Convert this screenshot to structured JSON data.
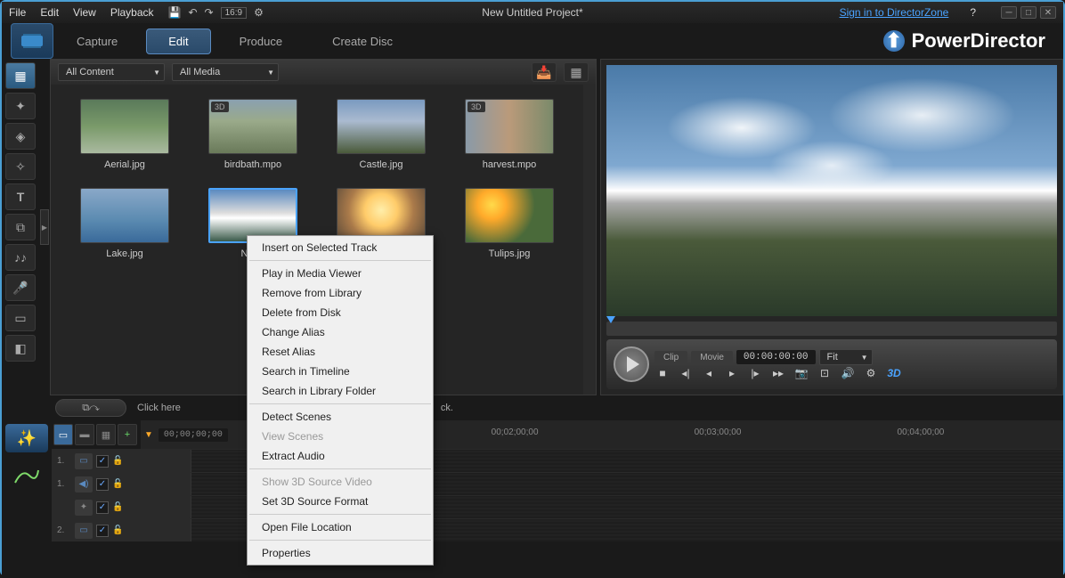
{
  "menubar": {
    "items": [
      "File",
      "Edit",
      "View",
      "Playback"
    ],
    "title": "New Untitled Project*",
    "signin": "Sign in to DirectorZone",
    "aspect": "16:9"
  },
  "tabs": {
    "items": [
      "Capture",
      "Edit",
      "Produce",
      "Create Disc"
    ],
    "active": 1,
    "brand": "PowerDirector"
  },
  "media": {
    "filter_content": "All Content",
    "filter_media": "All Media",
    "items": [
      {
        "label": "Aerial.jpg",
        "badge3d": false,
        "thumb": "th-aerial"
      },
      {
        "label": "birdbath.mpo",
        "badge3d": true,
        "thumb": "th-birdbath"
      },
      {
        "label": "Castle.jpg",
        "badge3d": false,
        "thumb": "th-castle"
      },
      {
        "label": "harvest.mpo",
        "badge3d": true,
        "thumb": "th-harvest"
      },
      {
        "label": "Lake.jpg",
        "badge3d": false,
        "thumb": "th-lake"
      },
      {
        "label": "Natur",
        "badge3d": false,
        "thumb": "th-nature",
        "selected": true
      },
      {
        "label": "",
        "badge3d": false,
        "thumb": "th-sunset"
      },
      {
        "label": "Tulips.jpg",
        "badge3d": false,
        "thumb": "th-tulips"
      }
    ]
  },
  "context_menu": [
    {
      "label": "Insert on Selected Track",
      "enabled": true
    },
    {
      "sep": true
    },
    {
      "label": "Play in Media Viewer",
      "enabled": true
    },
    {
      "label": "Remove from Library",
      "enabled": true
    },
    {
      "label": "Delete from Disk",
      "enabled": true
    },
    {
      "label": "Change Alias",
      "enabled": true
    },
    {
      "label": "Reset Alias",
      "enabled": true
    },
    {
      "label": "Search in Timeline",
      "enabled": true
    },
    {
      "label": "Search in Library Folder",
      "enabled": true
    },
    {
      "sep": true
    },
    {
      "label": "Detect Scenes",
      "enabled": true
    },
    {
      "label": "View Scenes",
      "enabled": false
    },
    {
      "label": "Extract Audio",
      "enabled": true
    },
    {
      "sep": true
    },
    {
      "label": "Show 3D Source Video",
      "enabled": false
    },
    {
      "label": "Set 3D Source Format",
      "enabled": true
    },
    {
      "sep": true
    },
    {
      "label": "Open File Location",
      "enabled": true
    },
    {
      "sep": true
    },
    {
      "label": "Properties",
      "enabled": true
    }
  ],
  "preview": {
    "toggle_clip": "Clip",
    "toggle_movie": "Movie",
    "timecode": "00:00:00:00",
    "fit": "Fit",
    "threed": "3D"
  },
  "hint": {
    "text_left": "Click here",
    "text_right": "ck."
  },
  "timeline": {
    "time0": "00;00;00;00",
    "ticks": [
      "00;02;00;00",
      "00;03;00;00",
      "00;04;00;00"
    ],
    "tracks": [
      {
        "num": "1.",
        "icon": "film",
        "color": "#5a8ac0"
      },
      {
        "num": "1.",
        "icon": "audio",
        "color": "#5a8ac0"
      },
      {
        "num": "",
        "icon": "fx",
        "color": "#888"
      },
      {
        "num": "2.",
        "icon": "film",
        "color": "#5a8ac0"
      }
    ]
  }
}
